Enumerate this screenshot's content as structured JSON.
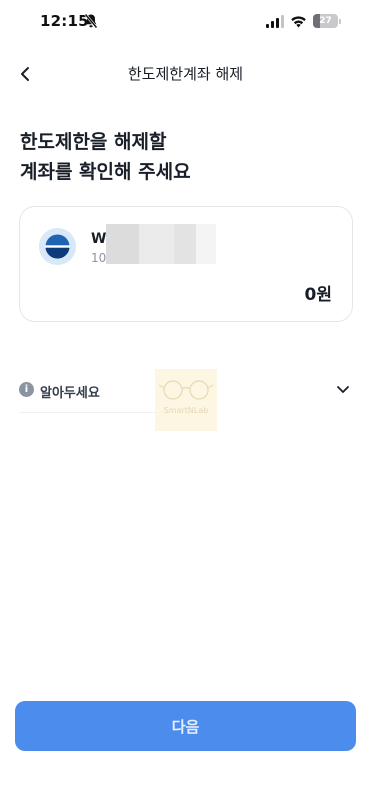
{
  "status_bar": {
    "time": "12:15",
    "battery_level": "27",
    "icons": [
      "bell-off-icon",
      "signal-icon",
      "wifi-icon",
      "battery-icon"
    ]
  },
  "nav": {
    "back_icon": "chevron-left-icon",
    "title": "한도제한계좌 해제"
  },
  "heading": {
    "line1": "한도제한을 해제할",
    "line2": "계좌를 확인해 주세요"
  },
  "account": {
    "name": "W",
    "number": "10",
    "balance": "0원",
    "logo_icon": "bank-logo-icon"
  },
  "notice": {
    "label": "알아두세요",
    "info_icon": "info-icon",
    "info_glyph": "i",
    "expand_icon": "chevron-down-icon"
  },
  "watermark": {
    "text": "SmartNLab"
  },
  "footer": {
    "next_label": "다음"
  },
  "colors": {
    "primary": "#4c8cec",
    "text": "#191f28",
    "subtext": "#8b95a1",
    "border": "#e3e6ea"
  }
}
